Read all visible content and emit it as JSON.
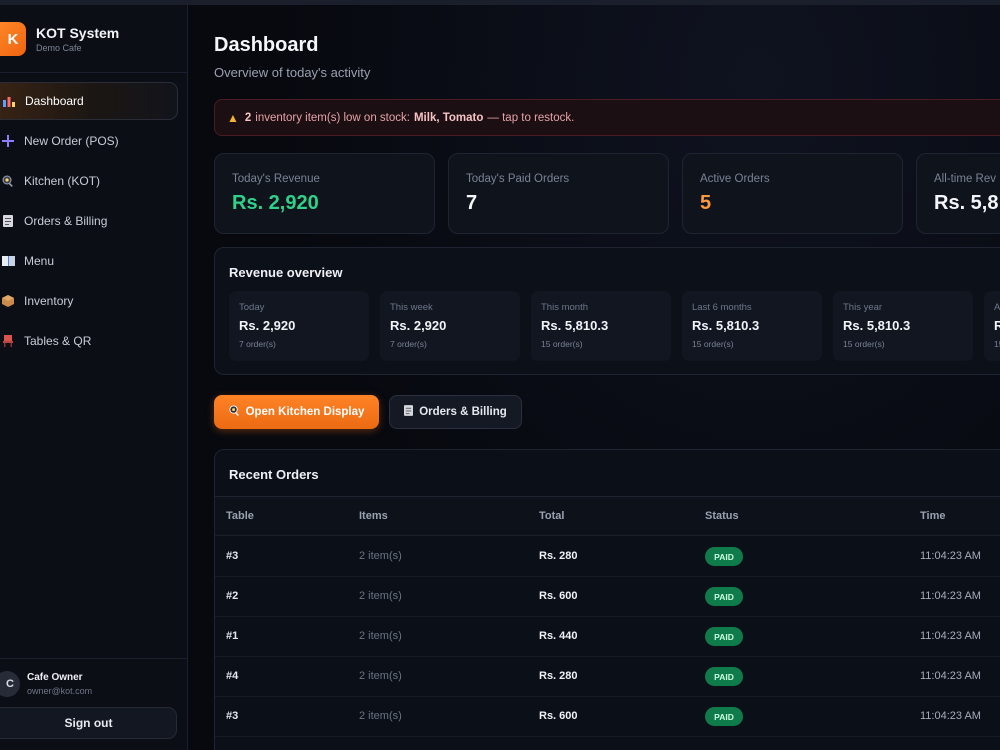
{
  "colors": {
    "accent": "#f57a1e",
    "revenue_green": "#2fd28a",
    "active_orange": "#ff9a3c",
    "paid_badge": "#0f7a4a"
  },
  "brand": {
    "logo_letter": "K",
    "title": "KOT System",
    "subtitle": "Demo Cafe"
  },
  "sidebar": {
    "items": [
      {
        "label": "Dashboard",
        "icon": "bar-chart-icon",
        "active": true
      },
      {
        "label": "New Order (POS)",
        "icon": "plus-icon",
        "active": false
      },
      {
        "label": "Kitchen (KOT)",
        "icon": "frying-pan-icon",
        "active": false
      },
      {
        "label": "Orders & Billing",
        "icon": "receipt-icon",
        "active": false
      },
      {
        "label": "Menu",
        "icon": "book-icon",
        "active": false
      },
      {
        "label": "Inventory",
        "icon": "box-icon",
        "active": false
      },
      {
        "label": "Tables & QR",
        "icon": "chair-icon",
        "active": false
      }
    ]
  },
  "user": {
    "initial": "C",
    "name": "Cafe Owner",
    "email": "owner@kot.com",
    "signout_label": "Sign out"
  },
  "header": {
    "title": "Dashboard",
    "subtitle": "Overview of today's activity"
  },
  "alert": {
    "count": "2",
    "text_before": "inventory item(s) low on stock:",
    "items": "Milk, Tomato",
    "text_after": "— tap to restock."
  },
  "stats": [
    {
      "label": "Today's Revenue",
      "value": "Rs. 2,920"
    },
    {
      "label": "Today's Paid Orders",
      "value": "7"
    },
    {
      "label": "Active Orders",
      "value": "5"
    },
    {
      "label": "All-time Rev",
      "value": "Rs. 5,8"
    }
  ],
  "revenue_overview": {
    "title": "Revenue overview",
    "cells": [
      {
        "label": "Today",
        "value": "Rs. 2,920",
        "orders": "7 order(s)"
      },
      {
        "label": "This week",
        "value": "Rs. 2,920",
        "orders": "7 order(s)"
      },
      {
        "label": "This month",
        "value": "Rs. 5,810.3",
        "orders": "15 order(s)"
      },
      {
        "label": "Last 6 months",
        "value": "Rs. 5,810.3",
        "orders": "15 order(s)"
      },
      {
        "label": "This year",
        "value": "Rs. 5,810.3",
        "orders": "15 order(s)"
      },
      {
        "label": "A",
        "value": "R",
        "orders": "15"
      }
    ]
  },
  "actions": {
    "kitchen_label": "Open Kitchen Display",
    "orders_label": "Orders & Billing"
  },
  "recent_orders": {
    "title": "Recent Orders",
    "columns": [
      "Table",
      "Items",
      "Total",
      "Status",
      "Time"
    ],
    "rows": [
      {
        "table": "#3",
        "items": "2 item(s)",
        "total": "Rs. 280",
        "status": "PAID",
        "time": "11:04:23 AM"
      },
      {
        "table": "#2",
        "items": "2 item(s)",
        "total": "Rs. 600",
        "status": "PAID",
        "time": "11:04:23 AM"
      },
      {
        "table": "#1",
        "items": "2 item(s)",
        "total": "Rs. 440",
        "status": "PAID",
        "time": "11:04:23 AM"
      },
      {
        "table": "#4",
        "items": "2 item(s)",
        "total": "Rs. 280",
        "status": "PAID",
        "time": "11:04:23 AM"
      },
      {
        "table": "#3",
        "items": "2 item(s)",
        "total": "Rs. 600",
        "status": "PAID",
        "time": "11:04:23 AM"
      }
    ]
  }
}
